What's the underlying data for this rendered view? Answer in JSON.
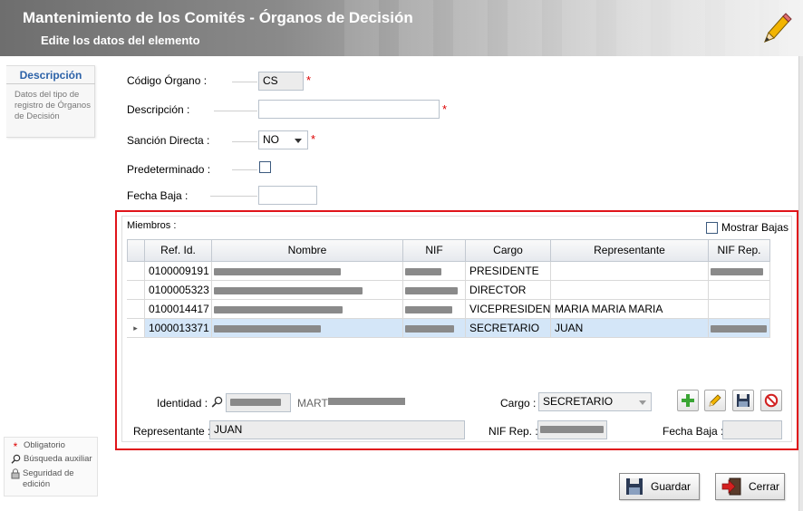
{
  "header": {
    "title": "Mantenimiento de los Comités - Órganos de Decisión",
    "subtitle": "Edite los datos del elemento"
  },
  "side": {
    "tab_title": "Descripción",
    "tab_desc": "Datos del tipo de registro de Órganos de Decisión"
  },
  "legend": {
    "required": "Obligatorio",
    "search": "Búsqueda auxiliar",
    "security": "Seguridad de edición"
  },
  "form": {
    "codigo_label": "Código Órgano :",
    "codigo_value": "CS",
    "descripcion_label": "Descripción :",
    "descripcion_value": "",
    "sancion_label": "Sanción Directa :",
    "sancion_value": "NO",
    "predeterminado_label": "Predeterminado :",
    "fecha_baja_label": "Fecha Baja :",
    "fecha_baja_value": "",
    "required_mark": "*"
  },
  "miembros": {
    "label": "Miembros :",
    "mostrar_bajas_label": "Mostrar Bajas",
    "columns": [
      "Ref. Id.",
      "Nombre",
      "NIF",
      "Cargo",
      "Representante",
      "NIF Rep."
    ],
    "rows": [
      {
        "ref": "0100009191",
        "cargo": "PRESIDENTE",
        "representante": ""
      },
      {
        "ref": "0100005323",
        "cargo": "DIRECTOR",
        "representante": ""
      },
      {
        "ref": "0100014417",
        "cargo": "VICEPRESIDENTE",
        "representante": "MARIA MARIA MARIA"
      },
      {
        "ref": "1000013371",
        "cargo": "SECRETARIO",
        "representante": "JUAN"
      }
    ],
    "selected_row_marker": "▸"
  },
  "detail": {
    "identidad_label": "Identidad :",
    "nombre_prefix": "MART",
    "cargo_label": "Cargo :",
    "cargo_value": "SECRETARIO",
    "representante_label": "Representante :",
    "representante_value": "JUAN",
    "nif_rep_label": "NIF Rep. :",
    "fecha_baja_label": "Fecha Baja :",
    "fecha_baja_value": ""
  },
  "buttons": {
    "guardar": "Guardar",
    "cerrar": "Cerrar"
  }
}
